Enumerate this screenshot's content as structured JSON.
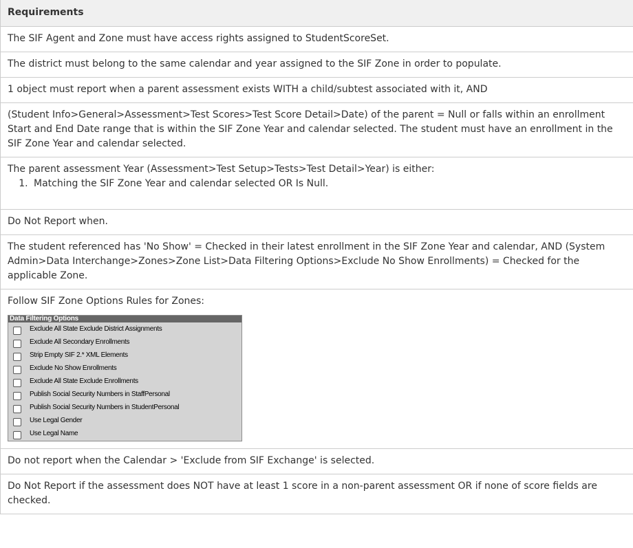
{
  "table": {
    "header": "Requirements",
    "rows": {
      "r1": "The SIF Agent and Zone must have access rights assigned to StudentScoreSet.",
      "r2": "The district must belong to the same calendar and year assigned to the SIF Zone in order to populate.",
      "r3": "1 object must report when a parent assessment exists WITH a child/subtest associated with it, AND",
      "r4": "(Student Info>General>Assessment>Test Scores>Test Score Detail>Date) of the parent = Null or falls within an enrollment Start and End Date range that is within the SIF Zone Year and calendar selected. The student must have an enrollment in the SIF Zone Year and calendar selected.",
      "r5_intro": "The parent assessment Year (Assessment>Test Setup>Tests>Test Detail>Year) is either:",
      "r5_item1": "Matching the SIF Zone Year and calendar selected OR Is Null.",
      "r6": "Do Not Report when.",
      "r7": "The student referenced has 'No Show' = Checked in their latest enrollment in the SIF Zone Year and calendar, AND (System Admin>Data Interchange>Zones>Zone List>Data Filtering Options>Exclude No Show Enrollments) = Checked for the applicable Zone.",
      "r8_intro": "Follow SIF Zone Options Rules for Zones:",
      "r9": "Do not report when the Calendar > 'Exclude from SIF Exchange' is selected.",
      "r10": "Do Not Report if the assessment does NOT have at least 1 score in a non-parent assessment OR if none of score fields are checked."
    }
  },
  "data_filtering_options": {
    "title": "Data Filtering Options",
    "items": [
      {
        "label": "Exclude All State Exclude District Assignments",
        "checked": false
      },
      {
        "label": "Exclude All Secondary Enrollments",
        "checked": false
      },
      {
        "label": "Strip Empty SIF 2.* XML Elements",
        "checked": false
      },
      {
        "label": "Exclude No Show Enrollments",
        "checked": false
      },
      {
        "label": "Exclude All State Exclude Enrollments",
        "checked": false
      },
      {
        "label": "Publish Social Security Numbers in StaffPersonal",
        "checked": false
      },
      {
        "label": "Publish Social Security Numbers in StudentPersonal",
        "checked": false
      },
      {
        "label": "Use Legal Gender",
        "checked": false
      },
      {
        "label": "Use Legal Name",
        "checked": false
      }
    ]
  }
}
